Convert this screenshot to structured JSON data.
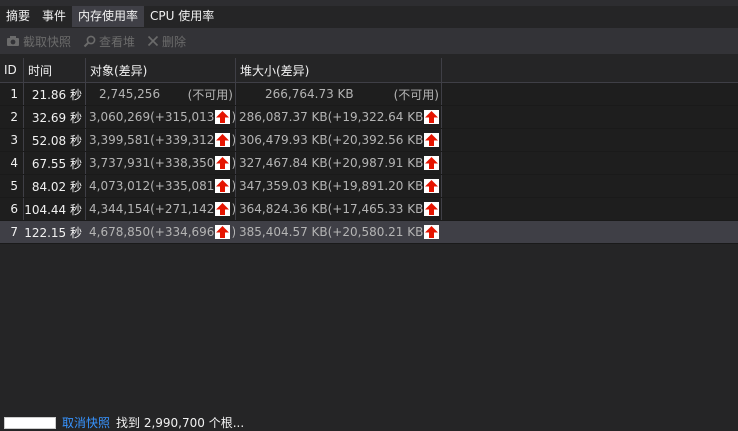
{
  "tabs": [
    {
      "label": "摘要"
    },
    {
      "label": "事件"
    },
    {
      "label": "内存使用率",
      "active": true
    },
    {
      "label": "CPU 使用率"
    }
  ],
  "toolbar": {
    "snapshot_label": "截取快照",
    "view_heap_label": "查看堆",
    "delete_label": "删除"
  },
  "table": {
    "headers": {
      "id": "ID",
      "time": "时间",
      "objects": "对象(差异)",
      "heap": "堆大小(差异)"
    },
    "rows": [
      {
        "id": "1",
        "time": "21.86 秒",
        "objects": "2,745,256",
        "objects_diff": "(不可用)",
        "heap": "266,764.73 KB",
        "heap_diff": "(不可用)"
      },
      {
        "id": "2",
        "time": "32.69 秒",
        "objects": "3,060,269",
        "objects_diff": "(+315,013",
        "heap": "286,087.37 KB",
        "heap_diff": "(+19,322.64 KB"
      },
      {
        "id": "3",
        "time": "52.08 秒",
        "objects": "3,399,581",
        "objects_diff": "(+339,312",
        "heap": "306,479.93 KB",
        "heap_diff": "(+20,392.56 KB"
      },
      {
        "id": "4",
        "time": "67.55 秒",
        "objects": "3,737,931",
        "objects_diff": "(+338,350",
        "heap": "327,467.84 KB",
        "heap_diff": "(+20,987.91 KB"
      },
      {
        "id": "5",
        "time": "84.02 秒",
        "objects": "4,073,012",
        "objects_diff": "(+335,081",
        "heap": "347,359.03 KB",
        "heap_diff": "(+19,891.20 KB"
      },
      {
        "id": "6",
        "time": "104.44 秒",
        "objects": "4,344,154",
        "objects_diff": "(+271,142",
        "heap": "364,824.36 KB",
        "heap_diff": "(+17,465.33 KB"
      },
      {
        "id": "7",
        "time": "122.15 秒",
        "objects": "4,678,850",
        "objects_diff": "(+334,696",
        "heap": "385,404.57 KB",
        "heap_diff": "(+20,580.21 KB"
      }
    ],
    "close_paren": ")"
  },
  "status": {
    "cancel_label": "取消快照",
    "found_text": "找到 2,990,700 个根..."
  },
  "colors": {
    "accent": "#3794ff",
    "arrow": "#e51400"
  }
}
